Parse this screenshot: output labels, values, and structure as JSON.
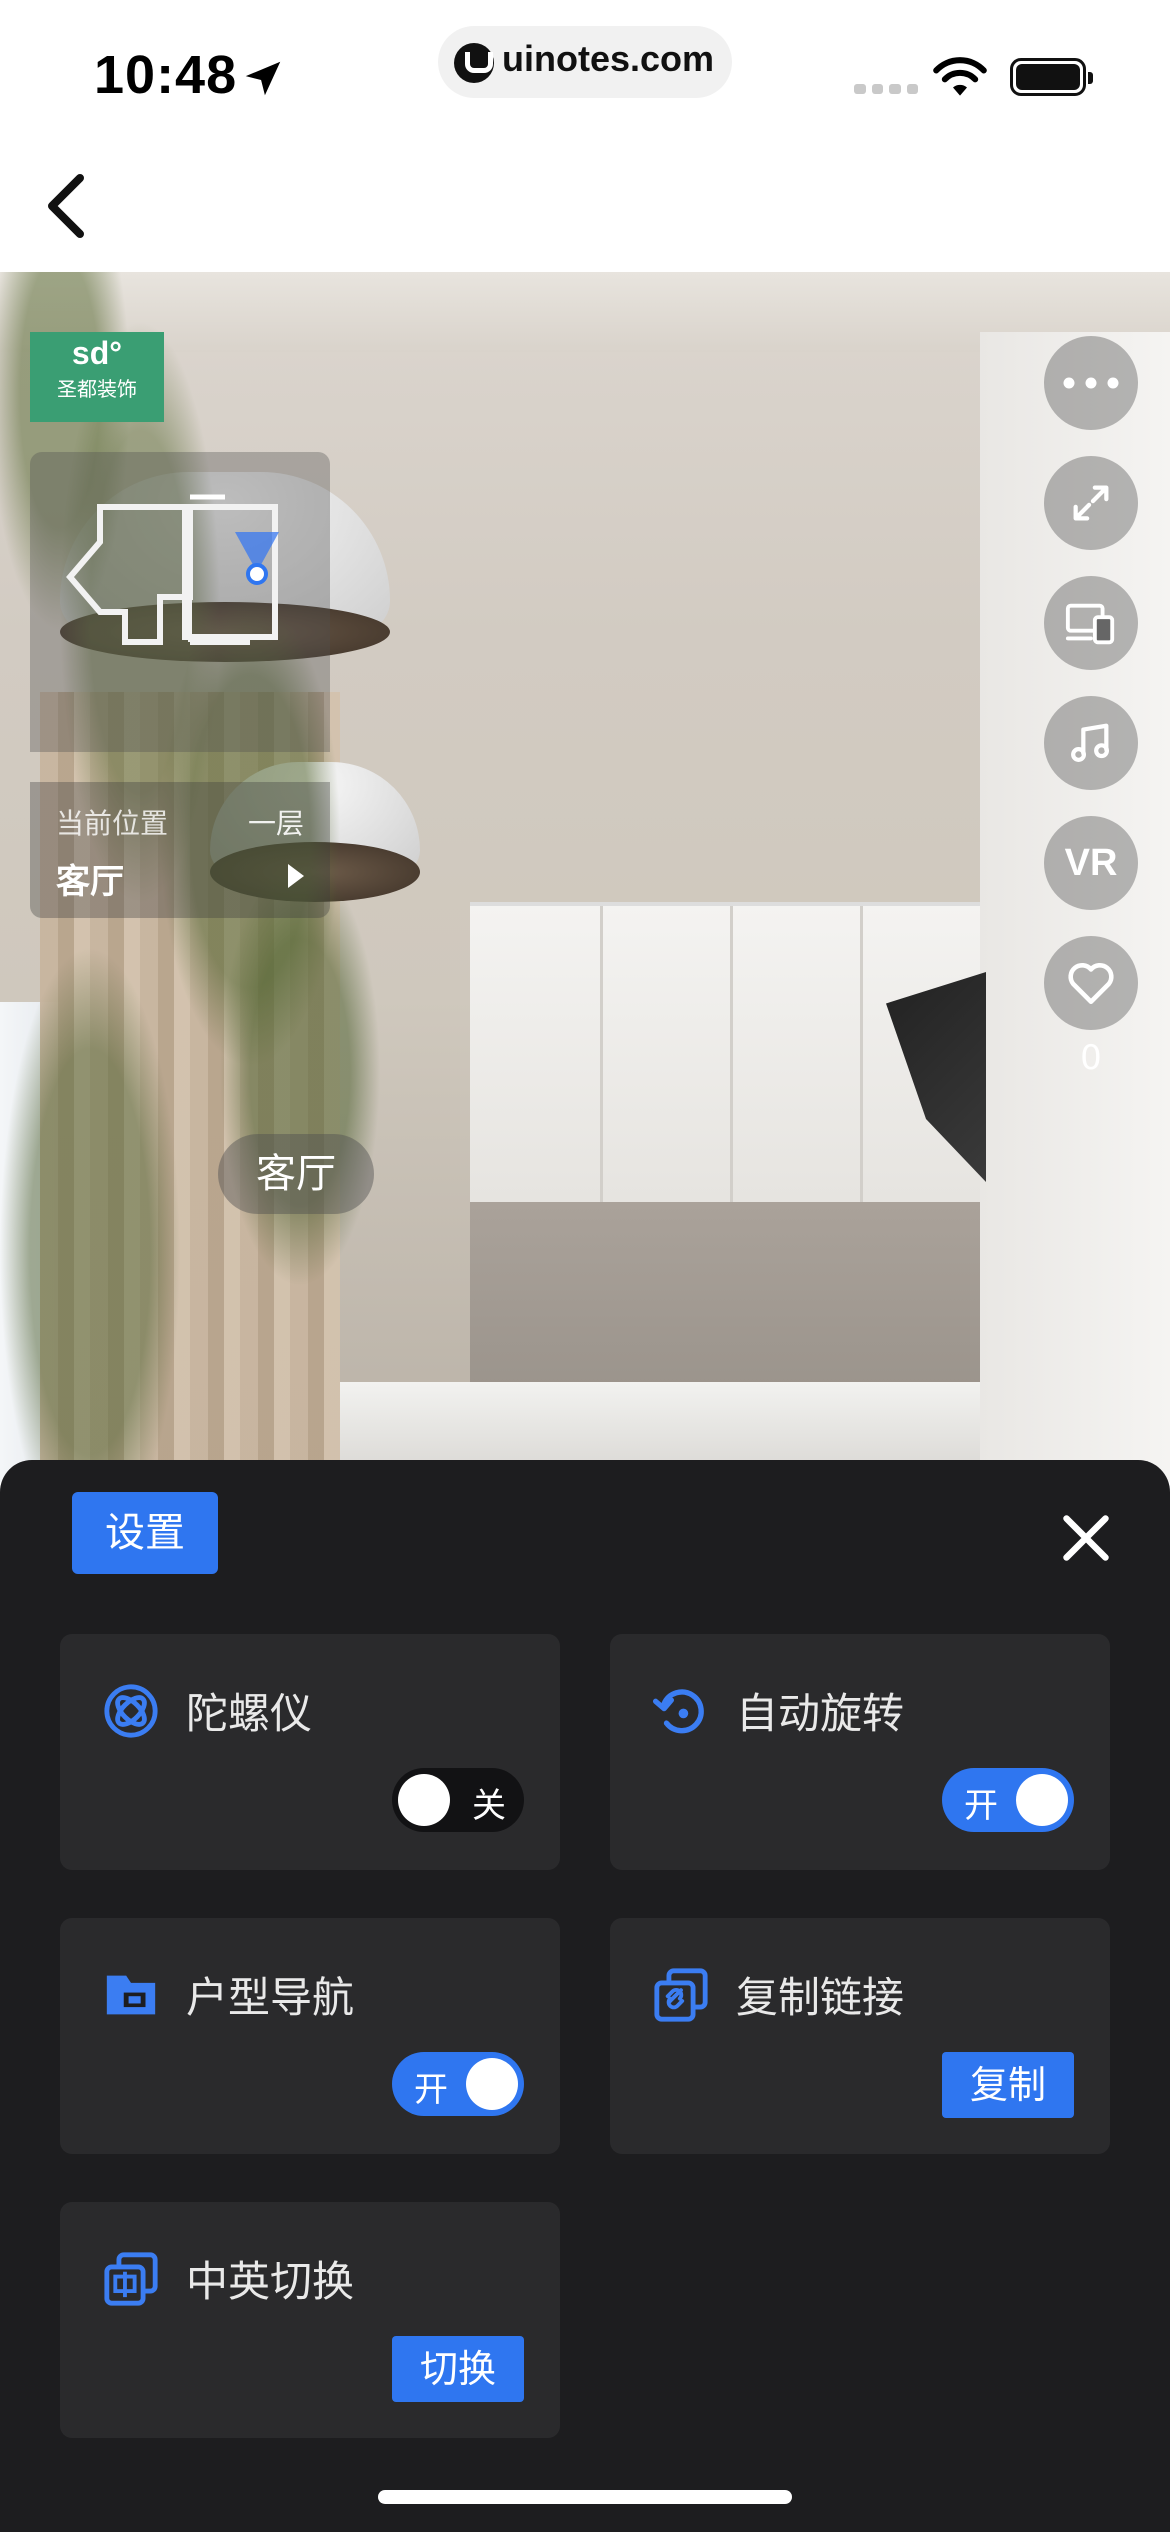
{
  "status_bar": {
    "time": "10:48",
    "url": "uinotes.com"
  },
  "viewer": {
    "brand_logo": "sd°",
    "brand_name": "圣都装饰",
    "current_location_label": "当前位置",
    "floor": "一层",
    "room": "客厅",
    "hotspot_label": "客厅",
    "vr_label": "VR",
    "like_count": "0",
    "tools": [
      "more-icon",
      "fullscreen-icon",
      "devices-icon",
      "music-icon",
      "vr",
      "heart-icon"
    ]
  },
  "settings": {
    "title": "设置",
    "items": [
      {
        "label": "陀螺仪",
        "icon": "gyroscope-icon",
        "control": "toggle",
        "state": "off",
        "state_text": "关"
      },
      {
        "label": "自动旋转",
        "icon": "auto-rotate-icon",
        "control": "toggle",
        "state": "on",
        "state_text": "开"
      },
      {
        "label": "户型导航",
        "icon": "floorplan-nav-icon",
        "control": "toggle",
        "state": "on",
        "state_text": "开"
      },
      {
        "label": "复制链接",
        "icon": "copy-link-icon",
        "control": "button",
        "button_text": "复制"
      },
      {
        "label": "中英切换",
        "icon": "language-switch-icon",
        "control": "button",
        "button_text": "切换"
      }
    ]
  },
  "colors": {
    "accent": "#2f76f0",
    "sheet_bg": "#1d1d1f",
    "card_bg": "#2a2a2c",
    "brand_green": "#3a9e73"
  }
}
